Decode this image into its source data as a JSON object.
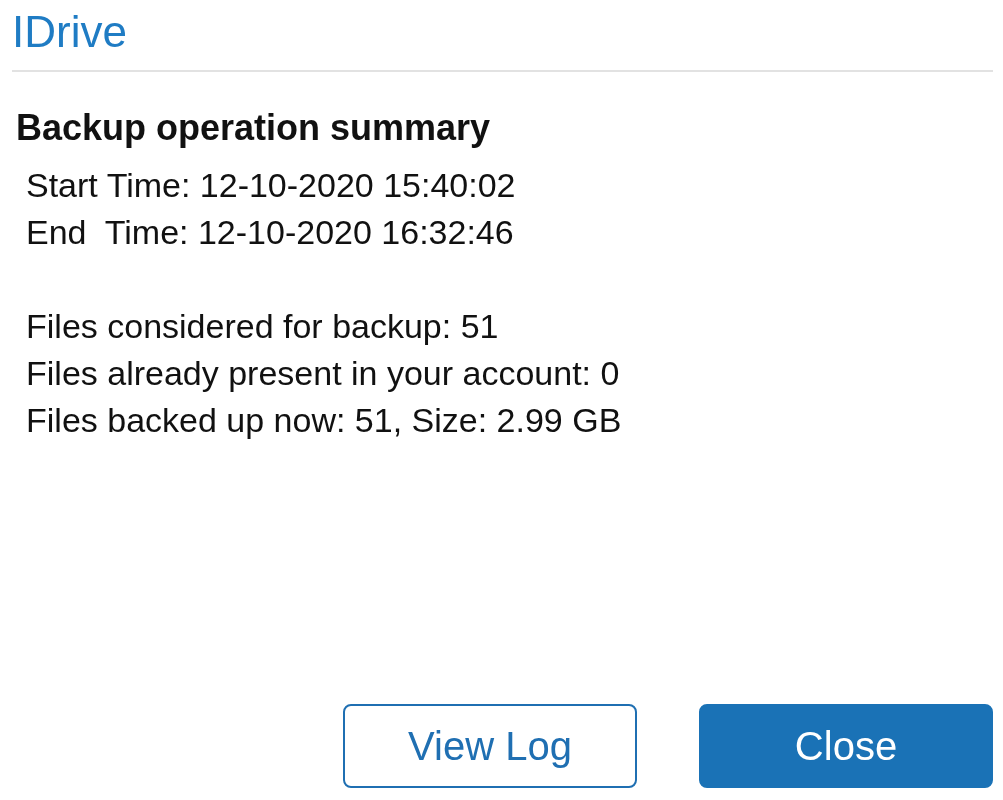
{
  "app": {
    "title": "IDrive"
  },
  "summary": {
    "heading": "Backup operation summary",
    "times": [
      "Start Time: 12-10-2020 15:40:02",
      "End  Time: 12-10-2020 16:32:46"
    ],
    "counts": [
      "Files considered for backup: 51",
      "Files already present in your account: 0",
      "Files backed up now: 51, Size: 2.99 GB"
    ]
  },
  "buttons": [
    {
      "label": "View Log",
      "kind": "secondary"
    },
    {
      "label": "Close",
      "kind": "primary"
    }
  ]
}
